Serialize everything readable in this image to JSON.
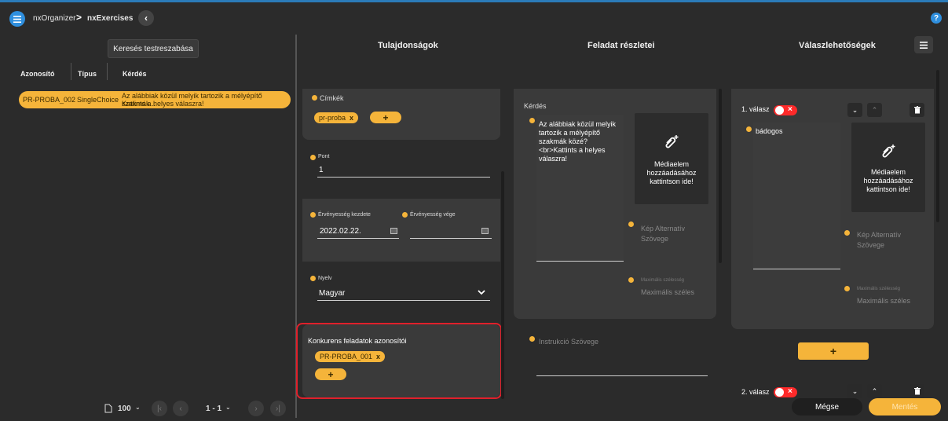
{
  "breadcrumb": {
    "root": "nxOrganizer",
    "separator": ">",
    "current": "nxExercises"
  },
  "help": "?",
  "search_tooltip": "Keresés testreszabása",
  "table": {
    "columns": [
      "Azonosító",
      "Típus",
      "Kérdés"
    ],
    "rows": [
      {
        "id": "PR-PROBA_002",
        "type": "SingleChoice",
        "question_line1": "Az alábbiak közül melyik tartozik a mélyépítő szakmák...",
        "question_line2": "Kattints a helyes válaszra!"
      }
    ]
  },
  "pagination": {
    "page_size": "100",
    "range": "1 - 1"
  },
  "sections": {
    "properties": "Tulajdonságok",
    "details": "Feladat részletei",
    "answers": "Válaszlehetőségek"
  },
  "properties": {
    "tags_label": "Címkék",
    "tags": [
      "pr-proba"
    ],
    "chip_remove": "x",
    "add": "+",
    "points_label": "Pont",
    "points_value": "1",
    "valid_from_label": "Érvényesség kezdete",
    "valid_from_value": "2022.02.22.",
    "valid_to_label": "Érvényesség vége",
    "language_label": "Nyelv",
    "language_value": "Magyar",
    "concurrent_label": "Konkurens feladatok azonosítói",
    "concurrent_ids": [
      "PR-PROBA_001"
    ]
  },
  "details": {
    "question_label": "Kérdés",
    "question_text": "Az alábbiak közül melyik tartozik a mélyépítő szakmák közé?<br>Kattints a helyes válaszra!",
    "media_text": "Médiaelem hozzáadásához kattintson ide!",
    "alt_placeholder": "Kép Alternatív Szövege",
    "max_width_label": "Maximális szélesség",
    "max_width_placeholder": "Maximális széles",
    "instruction_placeholder": "Instrukció Szövege"
  },
  "answers": [
    {
      "label": "1. válasz",
      "text": "bádogos"
    },
    {
      "label": "2. válasz",
      "text": ""
    }
  ],
  "footer": {
    "cancel": "Mégse",
    "save": "Mentés"
  },
  "colors": {
    "accent": "#f5b43a",
    "primary": "#2f8fde",
    "danger": "#e0202b"
  }
}
